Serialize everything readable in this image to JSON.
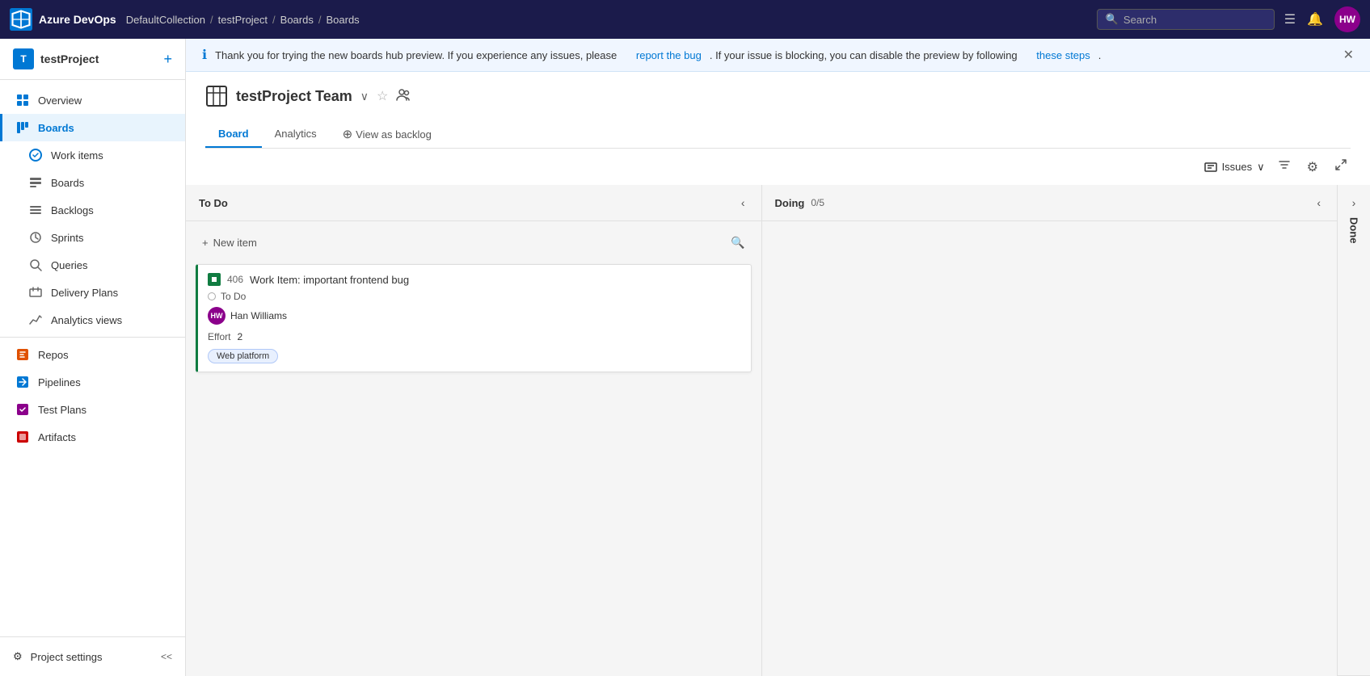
{
  "app": {
    "name": "Azure DevOps",
    "logo_text": "Azure DevOps"
  },
  "topbar": {
    "breadcrumbs": [
      "DefaultCollection",
      "testProject",
      "Boards",
      "Boards"
    ],
    "search_placeholder": "Search",
    "user_initials": "HW"
  },
  "sidebar": {
    "project_icon": "T",
    "project_name": "testProject",
    "add_label": "+",
    "nav_items": [
      {
        "id": "overview",
        "label": "Overview",
        "icon": "grid"
      },
      {
        "id": "boards",
        "label": "Boards",
        "icon": "boards",
        "active": true
      },
      {
        "id": "workitems",
        "label": "Work items",
        "icon": "workitems"
      },
      {
        "id": "boards2",
        "label": "Boards",
        "icon": "boards2"
      },
      {
        "id": "backlogs",
        "label": "Backlogs",
        "icon": "backlogs"
      },
      {
        "id": "sprints",
        "label": "Sprints",
        "icon": "sprints"
      },
      {
        "id": "queries",
        "label": "Queries",
        "icon": "queries"
      },
      {
        "id": "delivery",
        "label": "Delivery Plans",
        "icon": "delivery"
      },
      {
        "id": "analytics",
        "label": "Analytics views",
        "icon": "analytics"
      },
      {
        "id": "repos",
        "label": "Repos",
        "icon": "repos"
      },
      {
        "id": "pipelines",
        "label": "Pipelines",
        "icon": "pipelines"
      },
      {
        "id": "testplans",
        "label": "Test Plans",
        "icon": "testplans"
      },
      {
        "id": "artifacts",
        "label": "Artifacts",
        "icon": "artifacts"
      }
    ],
    "settings_label": "Project settings",
    "collapse_icon": "<<"
  },
  "notice": {
    "text_before": "Thank you for trying the new boards hub preview. If you experience any issues, please",
    "link1_text": "report the bug",
    "text_middle": ". If your issue is blocking, you can disable the preview by following",
    "link2_text": "these steps",
    "text_after": "."
  },
  "board": {
    "icon": "▦",
    "title": "testProject Team",
    "chevron": "∨",
    "tabs": [
      {
        "id": "board",
        "label": "Board",
        "active": true
      },
      {
        "id": "analytics",
        "label": "Analytics",
        "active": false
      }
    ],
    "view_as_backlog": "View as backlog",
    "toolbar": {
      "issues_label": "Issues",
      "filter_icon": "⊛",
      "settings_icon": "⚙",
      "fullscreen_icon": "⛶"
    },
    "columns": [
      {
        "id": "todo",
        "title": "To Do",
        "count": null,
        "collapsed": false,
        "cards": [
          {
            "id": "406",
            "title": "Work Item: important frontend bug",
            "status": "To Do",
            "assignee": "Han Williams",
            "assignee_initials": "HW",
            "effort_label": "Effort",
            "effort_value": "2",
            "tag": "Web platform"
          }
        ]
      },
      {
        "id": "doing",
        "title": "Doing",
        "count": "0/5",
        "collapsed": false,
        "cards": []
      },
      {
        "id": "done",
        "title": "Done",
        "count": null,
        "collapsed": true,
        "cards": []
      }
    ]
  }
}
